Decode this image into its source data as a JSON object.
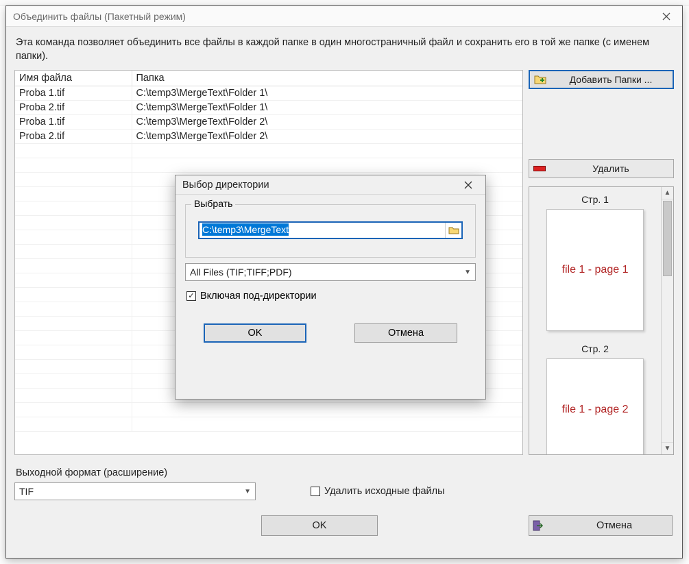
{
  "window": {
    "title": "Объединить файлы (Пакетный режим)",
    "description": "Эта команда позволяет объединить все файлы в каждой папке в один многостраничный файл и сохранить его в той же папке (с именем папки)."
  },
  "table": {
    "col_name": "Имя файла",
    "col_folder": "Папка",
    "rows": [
      {
        "name": "Proba 1.tif",
        "folder": "C:\\temp3\\MergeText\\Folder 1\\"
      },
      {
        "name": "Proba 2.tif",
        "folder": "C:\\temp3\\MergeText\\Folder 1\\"
      },
      {
        "name": "Proba 1.tif",
        "folder": "C:\\temp3\\MergeText\\Folder 2\\"
      },
      {
        "name": "Proba 2.tif",
        "folder": "C:\\temp3\\MergeText\\Folder 2\\"
      }
    ]
  },
  "side": {
    "add_label": "Добавить Папки ...",
    "delete_label": "Удалить"
  },
  "preview": {
    "pages": [
      {
        "label": "Стр. 1",
        "text": "file 1 - page 1"
      },
      {
        "label": "Стр. 2",
        "text": "file 1 - page 2"
      }
    ]
  },
  "output": {
    "label": "Выходной формат (расширение)",
    "value": "TIF",
    "delete_src_label": "Удалить исходные файлы",
    "delete_src_checked": false
  },
  "footer": {
    "ok": "OK",
    "cancel": "Отмена"
  },
  "dialog": {
    "title": "Выбор директории",
    "group_label": "Выбрать",
    "path": "C:\\temp3\\MergeText",
    "type_value": "All Files (TIF;TIFF;PDF)",
    "subdirs_label": "Включая под-директории",
    "subdirs_checked": true,
    "ok": "OK",
    "cancel": "Отмена"
  }
}
